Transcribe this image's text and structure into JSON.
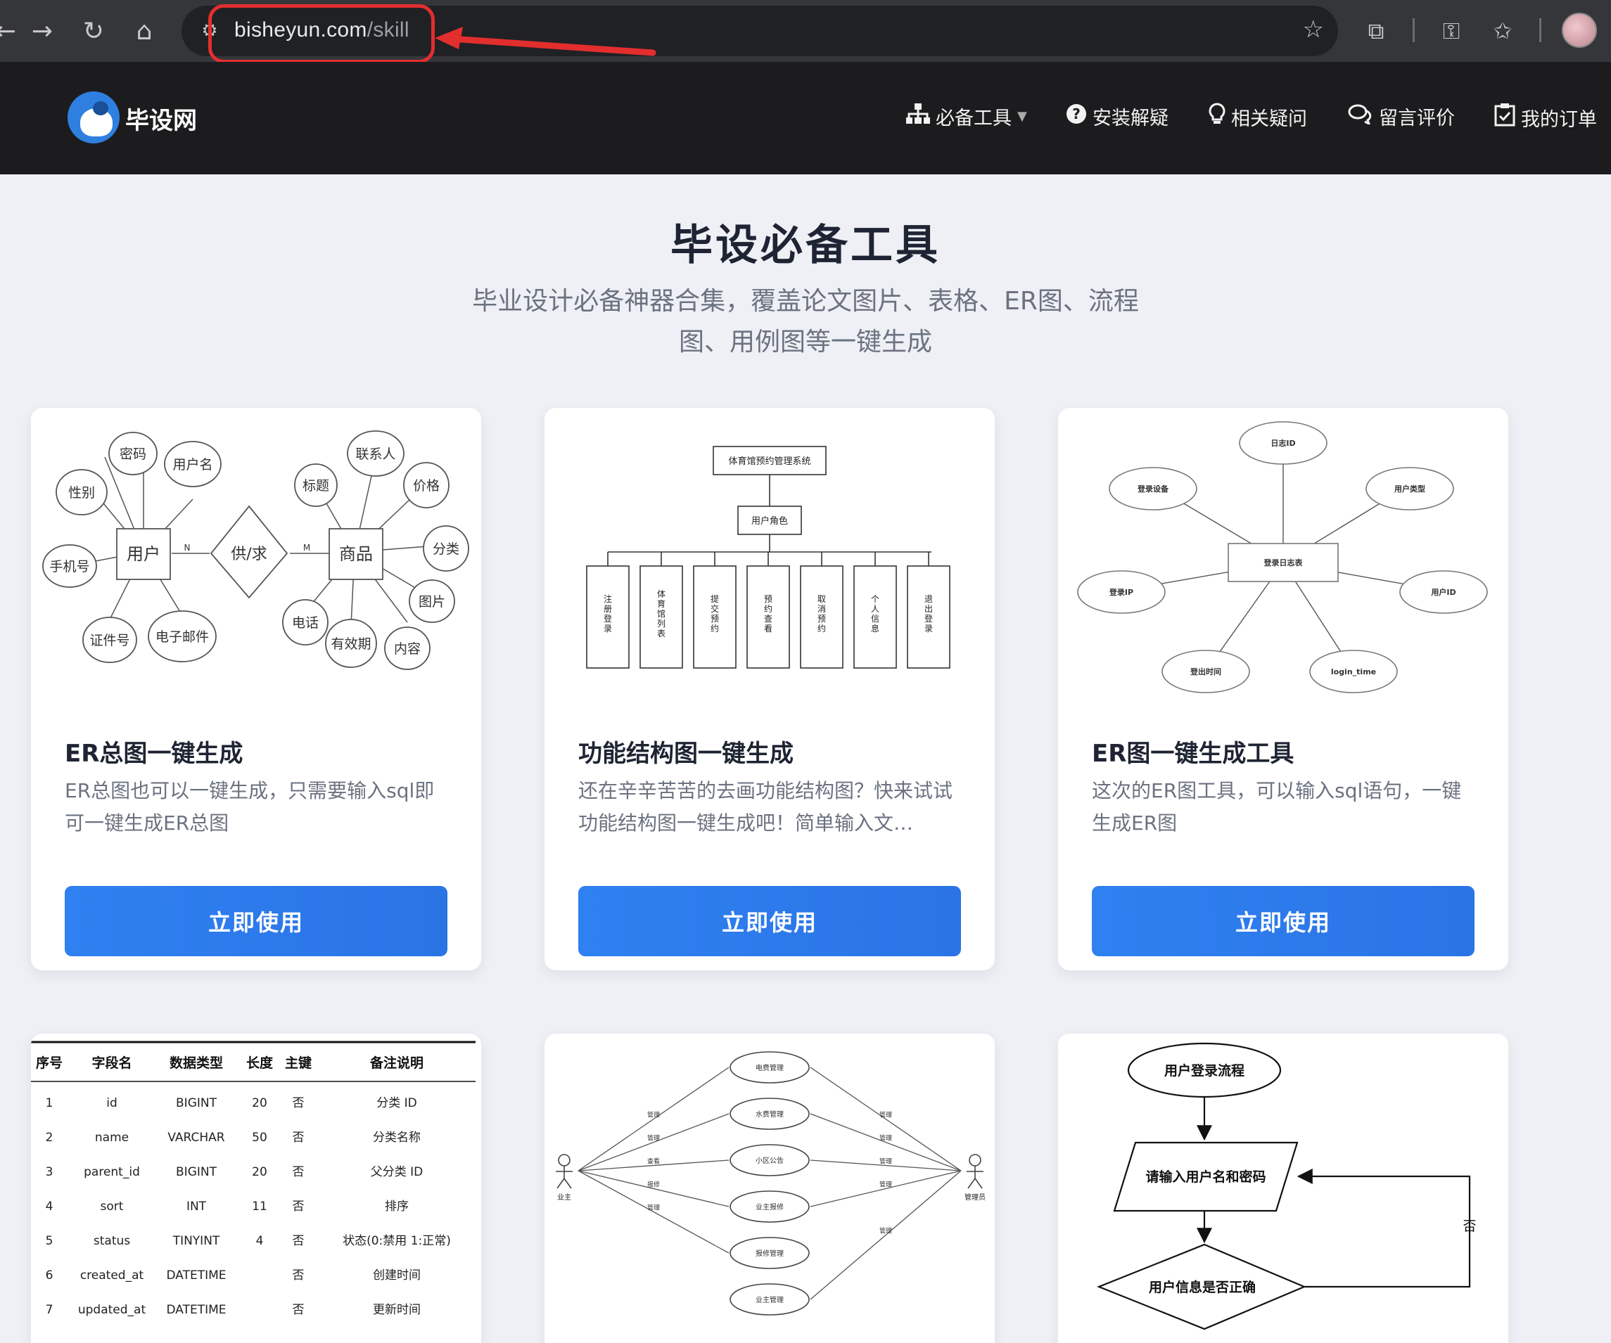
{
  "browser": {
    "url_host": "bisheyun.com",
    "url_path": "/skill"
  },
  "site": {
    "logo_text": "毕设网",
    "nav": [
      {
        "label": "必备工具",
        "icon": "sitemap-icon"
      },
      {
        "label": "安装解疑",
        "icon": "question-circle-icon"
      },
      {
        "label": "相关疑问",
        "icon": "lightbulb-icon"
      },
      {
        "label": "留言评价",
        "icon": "chat-bubbles-icon"
      },
      {
        "label": "我的订单",
        "icon": "clipboard-check-icon"
      }
    ]
  },
  "hero": {
    "title": "毕设必备工具",
    "subtitle": "毕业设计必备神器合集，覆盖论文图片、表格、ER图、流程图、用例图等一键生成"
  },
  "cards": [
    {
      "title": "ER总图一键生成",
      "desc": "ER总图也可以一键生成，只需要输入sql即可一键生成ER总图",
      "button": "立即使用"
    },
    {
      "title": "功能结构图一键生成",
      "desc": "还在辛辛苦苦的去画功能结构图？快来试试功能结构图一键生成吧！简单输入文…",
      "button": "立即使用"
    },
    {
      "title": "ER图一键生成工具",
      "desc": "这次的ER图工具，可以输入sql语句，一键生成ER图",
      "button": "立即使用"
    }
  ],
  "er_total": {
    "left_entity": "用户",
    "relation": "供/求",
    "right_entity": "商品",
    "n_label": "N",
    "m_label": "M",
    "left_attrs": [
      "密码",
      "用户名",
      "性别",
      "手机号",
      "证件号",
      "电子邮件"
    ],
    "right_attrs": [
      "联系人",
      "标题",
      "价格",
      "分类",
      "图片",
      "电话",
      "有效期",
      "内容"
    ]
  },
  "func_struct": {
    "root": "体育馆预约管理系统",
    "mid": "用户角色",
    "leaves": [
      "注册登录",
      "体育馆列表",
      "提交预约",
      "预约查看",
      "取消预约",
      "个人信息",
      "退出登录"
    ]
  },
  "er_single": {
    "center": "登录日志表",
    "attrs": [
      "日志ID",
      "登录设备",
      "用户类型",
      "登录IP",
      "用户ID",
      "登出时间",
      "login_time"
    ]
  },
  "table_preview": {
    "headers": [
      "序号",
      "字段名",
      "数据类型",
      "长度",
      "主键",
      "备注说明"
    ],
    "rows": [
      [
        "1",
        "id",
        "BIGINT",
        "20",
        "否",
        "分类 ID"
      ],
      [
        "2",
        "name",
        "VARCHAR",
        "50",
        "否",
        "分类名称"
      ],
      [
        "3",
        "parent_id",
        "BIGINT",
        "20",
        "否",
        "父分类 ID"
      ],
      [
        "4",
        "sort",
        "INT",
        "11",
        "否",
        "排序"
      ],
      [
        "5",
        "status",
        "TINYINT",
        "4",
        "否",
        "状态(0:禁用 1:正常)"
      ],
      [
        "6",
        "created_at",
        "DATETIME",
        "",
        "否",
        "创建时间"
      ],
      [
        "7",
        "updated_at",
        "DATETIME",
        "",
        "否",
        "更新时间"
      ]
    ]
  },
  "usecase": {
    "left_actor": "业主",
    "right_actor": "管理员",
    "cases": [
      "电费管理",
      "水费管理",
      "小区公告",
      "业主报修",
      "报修管理",
      "业主管理"
    ],
    "left_links": [
      "管理",
      "管理",
      "查看",
      "报修",
      "管理"
    ],
    "right_links": [
      "管理",
      "管理",
      "管理",
      "管理",
      "管理"
    ]
  },
  "flowchart": {
    "start": "用户登录流程",
    "input": "请输入用户名和密码",
    "decision": "用户信息是否正确",
    "no_label": "否"
  }
}
